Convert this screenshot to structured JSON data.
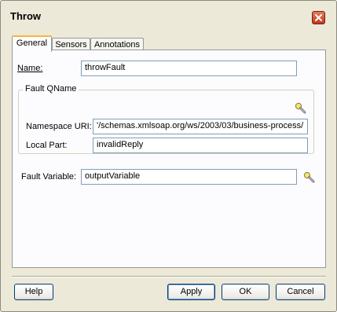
{
  "dialog": {
    "title": "Throw"
  },
  "tabs": [
    {
      "label": "General",
      "active": true
    },
    {
      "label": "Sensors",
      "active": false
    },
    {
      "label": "Annotations",
      "active": false
    }
  ],
  "form": {
    "name_label": "Name:",
    "name_value": "throwFault",
    "fault_qname_group": "Fault QName",
    "namespace_label": "Namespace URI:",
    "namespace_value": "'/schemas.xmlsoap.org/ws/2003/03/business-process/",
    "local_part_label": "Local Part:",
    "local_part_value": "invalidReply",
    "fault_variable_label": "Fault Variable:",
    "fault_variable_value": "outputVariable"
  },
  "buttons": {
    "help": "Help",
    "apply": "Apply",
    "ok": "OK",
    "cancel": "Cancel"
  },
  "icons": {
    "close": "close-x-icon",
    "browse": "flashlight-search-icon"
  },
  "colors": {
    "dialog_background": "#ece9d8",
    "close_button": "#c0391f",
    "active_tab_highlight": "#f7b63a",
    "field_border": "#7f9db9"
  }
}
